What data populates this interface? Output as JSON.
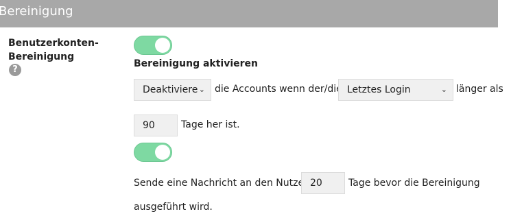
{
  "header": {
    "title": "Bereinigung"
  },
  "section": {
    "label_line1": "Benutzerkonten-",
    "label_line2": "Bereinigung",
    "help_glyph": "?"
  },
  "toggle1": {
    "state": "on"
  },
  "enable_label": "Bereinigung aktivieren",
  "rule": {
    "action_value": "Deaktiviere",
    "text_accounts": "die Accounts wenn der/die",
    "criteria_value": "Letztes Login",
    "text_longer": "länger als",
    "days_value": "90",
    "text_days": "Tage her ist."
  },
  "toggle2": {
    "state": "on"
  },
  "notify": {
    "text_before": "Sende eine Nachricht an den Nutzer",
    "days_value": "20",
    "text_after": "Tage bevor die Bereinigung",
    "text_line2": "ausgeführt wird."
  }
}
